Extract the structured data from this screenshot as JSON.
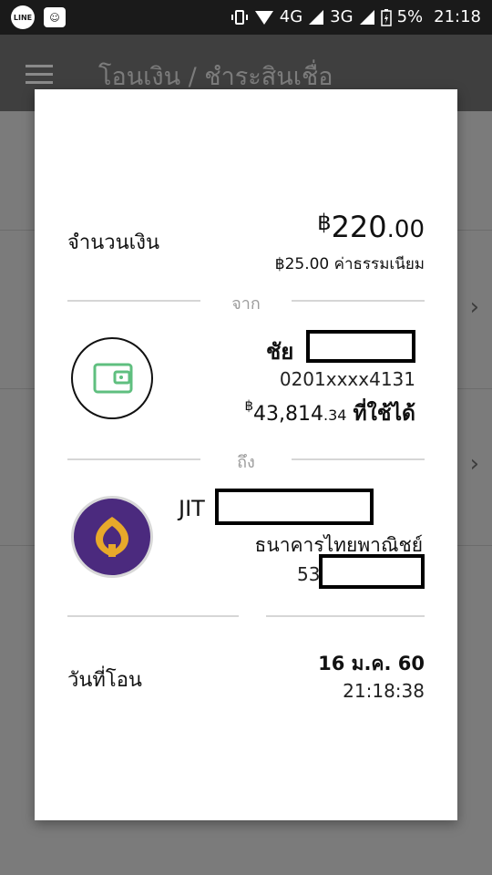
{
  "status_bar": {
    "left_icons": [
      "line-icon",
      "message-icon"
    ],
    "line_label": "LINE",
    "network_4g": "4G",
    "network_3g": "3G",
    "battery": "5%",
    "time": "21:18"
  },
  "app_bar": {
    "title": "โอนเงิน / ชำระสินเชื่อ"
  },
  "dialog": {
    "amount_label": "จำนวนเงิน",
    "amount_currency": "฿",
    "amount_integer": "220",
    "amount_decimal": ".00",
    "fee_text": "฿25.00 ค่าธรรมเนียม",
    "from_divider_label": "จาก",
    "from": {
      "name": "ชัย",
      "account": "0201xxxx4131",
      "balance_currency": "฿",
      "balance_integer": "43,814",
      "balance_decimal": ".34",
      "available_label": "ที่ใช้ได้",
      "icon": "wallet-icon"
    },
    "to_divider_label": "ถึง",
    "to": {
      "name": "JIT",
      "bank": "ธนาคารไทยพาณิชย์",
      "account": "53",
      "icon": "scb-logo"
    },
    "date_label": "วันที่โอน",
    "date_value": "16 ม.ค. 60",
    "time_value": "21:18:38"
  },
  "colors": {
    "status_bar": "#1a1a1a",
    "app_bar": "#3f3f3f",
    "overlay": "#7b7b7b",
    "bank_purple": "#4b2a7e",
    "bank_gold": "#e8a92a",
    "wallet_green": "#5fbf7f"
  }
}
